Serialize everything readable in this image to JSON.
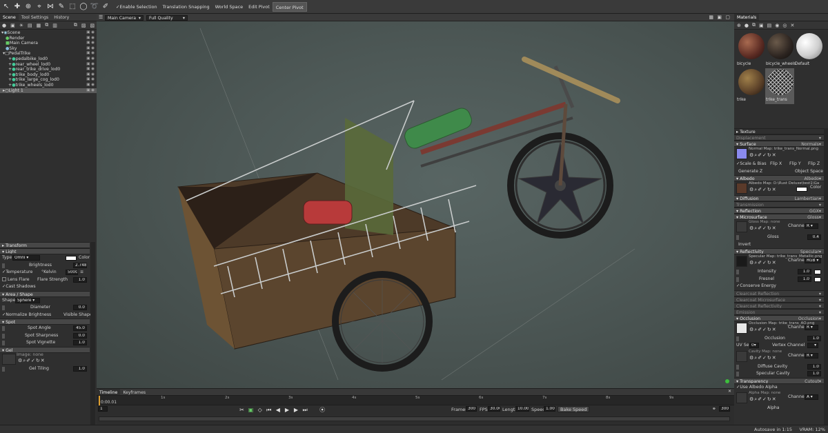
{
  "toolbar": {
    "items": [
      "Enable Selection",
      "Translation Snapping",
      "World Space",
      "Edit Pivot",
      "Center Pivot"
    ]
  },
  "left": {
    "tabs": [
      "Scene",
      "Tool Settings",
      "History"
    ],
    "tree": [
      "Scene",
      "Render",
      "Main Camera",
      "Sky",
      "PedalTrike",
      "pedalbike_lod0",
      "rear_wheel_lod0",
      "rear_trike_drive_lod0",
      "trike_body_lod0",
      "trike_large_cog_lod0",
      "trike_wheels_lod0",
      "Light 1"
    ]
  },
  "props": {
    "transform": "Transform",
    "light": "Light",
    "type_label": "Type",
    "type_value": "Omni",
    "color_label": "Color",
    "brightness_label": "Brightness",
    "brightness_value": "2.748",
    "temperature_label": "Temperature",
    "kelvin_label": "°Kelvin",
    "kelvin_value": "5000.",
    "lens_flare_label": "Lens Flare",
    "flare_strength_label": "Flare Strength",
    "flare_strength_value": "1.0",
    "cast_shadows_label": "Cast Shadows",
    "area_shape": "Area / Shape",
    "shape_label": "Shape",
    "shape_value": "Sphere",
    "diameter_label": "Diameter",
    "diameter_value": "0.0",
    "normalize_label": "Normalize Brightness",
    "visible_shape_label": "Visible Shape",
    "spot": "Spot",
    "spot_angle_label": "Spot Angle",
    "spot_angle_value": "45.0",
    "spot_sharp_label": "Spot Sharpness",
    "spot_sharp_value": "0.0",
    "spot_vig_label": "Spot Vignette",
    "spot_vig_value": "1.0",
    "gel": "Gel",
    "image_label": "Image: none",
    "gel_tiling_label": "Gel Tiling",
    "gel_tiling_value": "1.0"
  },
  "viewport": {
    "camera": "Main Camera",
    "quality": "Full Quality"
  },
  "timeline": {
    "tabs": [
      "Timeline",
      "Keyframes"
    ],
    "ticks": [
      "1s",
      "2s",
      "3s",
      "4s",
      "5s",
      "6s",
      "7s",
      "8s",
      "9s"
    ],
    "current_time": "0:00.01",
    "frame": "1",
    "frames_label": "Frames",
    "frames_value": "300",
    "fps_label": "FPS",
    "fps_value": "30.000",
    "length_label": "Length",
    "length_value": "10.000",
    "speed_label": "Speed",
    "speed_value": "1.000",
    "bake_label": "Bake Speed",
    "end_value": "300"
  },
  "status": {
    "text": "Autosave in 1:15",
    "vram": "VRAM: 12%"
  },
  "materials": {
    "title": "Materials",
    "items": [
      "bicycle",
      "bicycle_wheels",
      "Default",
      "trike",
      "trike_trans"
    ]
  },
  "right": {
    "texture": "Texture",
    "displacement": "Displacement",
    "surface": "Surface",
    "surface_value": "Normals",
    "normal_map": "Normal Map: trike_trans_Normal.png",
    "scale_bias": "Scale & Bias",
    "flip_x": "Flip X",
    "flip_y": "Flip Y",
    "flip_z": "Flip Z",
    "generate_z": "Generate Z",
    "object_space": "Object Space",
    "albedo": "Albedo",
    "albedo_value": "Albedo",
    "albedo_map": "Albedo Map: D:\\Rust Deluxe\\test1\\Ga",
    "color_label": "Color",
    "diffusion": "Diffusion",
    "diffusion_value": "Lambertian",
    "transmission": "Transmission",
    "reflection": "Reflection",
    "reflection_value": "GGX",
    "microsurface": "Microsurface",
    "microsurface_value": "Gloss",
    "gloss_map": "Gloss Map: none",
    "channel_label": "Channel",
    "channel_r": "R",
    "gloss_label": "Gloss",
    "gloss_value": "0.4",
    "invert_label": "Invert",
    "reflectivity": "Reflectivity",
    "reflectivity_value": "Specular",
    "spec_map": "Specular Map: trike_trans_Metallic.png",
    "channel_rgb": "RGB",
    "intensity_label": "Intensity",
    "intensity_value": "1.0",
    "fresnel_label": "Fresnel",
    "fresnel_value": "1.0",
    "conserve_label": "Conserve Energy",
    "clearcoat_refl": "Clearcoat Reflection",
    "clearcoat_micro": "Clearcoat Microsurface",
    "clearcoat_reflectivity": "Clearcoat Reflectivity",
    "emission": "Emission",
    "occlusion": "Occlusion",
    "occlusion_value": "Occlusion",
    "occ_map": "Occlusion Map: trike_trans_AO.png",
    "occlusion_label": "Occlusion",
    "occlusion_num": "1.0",
    "uv_set_label": "UV Set",
    "uv_set_value": "0",
    "vertex_channel_label": "Vertex Channel",
    "cavity_map": "Cavity Map: none",
    "diffuse_cavity_label": "Diffuse Cavity",
    "diffuse_cavity_value": "1.0",
    "specular_cavity_label": "Specular Cavity",
    "specular_cavity_value": "1.0",
    "transparency": "Transparency",
    "transparency_value": "Cutout",
    "use_albedo_alpha": "Use Albedo Alpha",
    "alpha_map": "Alpha Map: none",
    "channel_a": "A",
    "alpha_label": "Alpha"
  }
}
